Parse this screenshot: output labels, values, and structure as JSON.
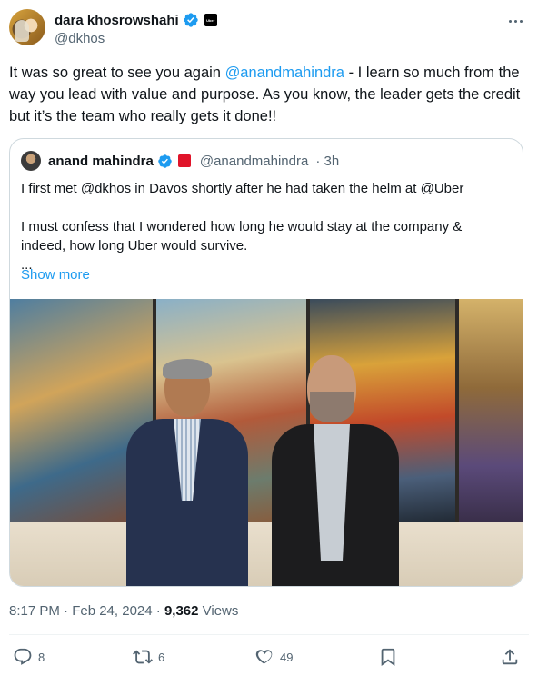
{
  "author": {
    "display_name": "dara khosrowshahi",
    "handle": "@dkhos",
    "org_badge_text": "Uber"
  },
  "tweet": {
    "text_before_mention": "It was so great to see you again ",
    "mention": "@anandmahindra",
    "text_after_mention": " - I learn so much from the way you lead with value and purpose.  As you know, the leader gets the credit but it’s the team who really gets it done!!"
  },
  "quote": {
    "display_name": "anand mahindra",
    "handle": "@anandmahindra",
    "time": "· 3h",
    "lines": [
      "I first met @dkhos in Davos shortly after he had taken the helm at @Uber",
      "",
      "I must confess that I wondered how long he would stay at the company &",
      "indeed, how long Uber would survive.",
      "..."
    ],
    "show_more": "Show more"
  },
  "meta": {
    "time_date": "8:17 PM · Feb 24, 2024 · ",
    "views_count": "9,362",
    "views_label": " Views"
  },
  "actions": {
    "replies": "8",
    "reposts": "6",
    "likes": "49"
  },
  "icons": {
    "verified": "verified-check-icon",
    "more": "more-dots-icon",
    "reply": "reply-bubble-icon",
    "repost": "repost-arrows-icon",
    "like": "heart-icon",
    "bookmark": "bookmark-icon",
    "share": "share-upload-icon"
  },
  "colors": {
    "link": "#1d9bf0",
    "secondary_text": "#536471",
    "primary_text": "#0f1419",
    "border": "#cfd9de"
  }
}
